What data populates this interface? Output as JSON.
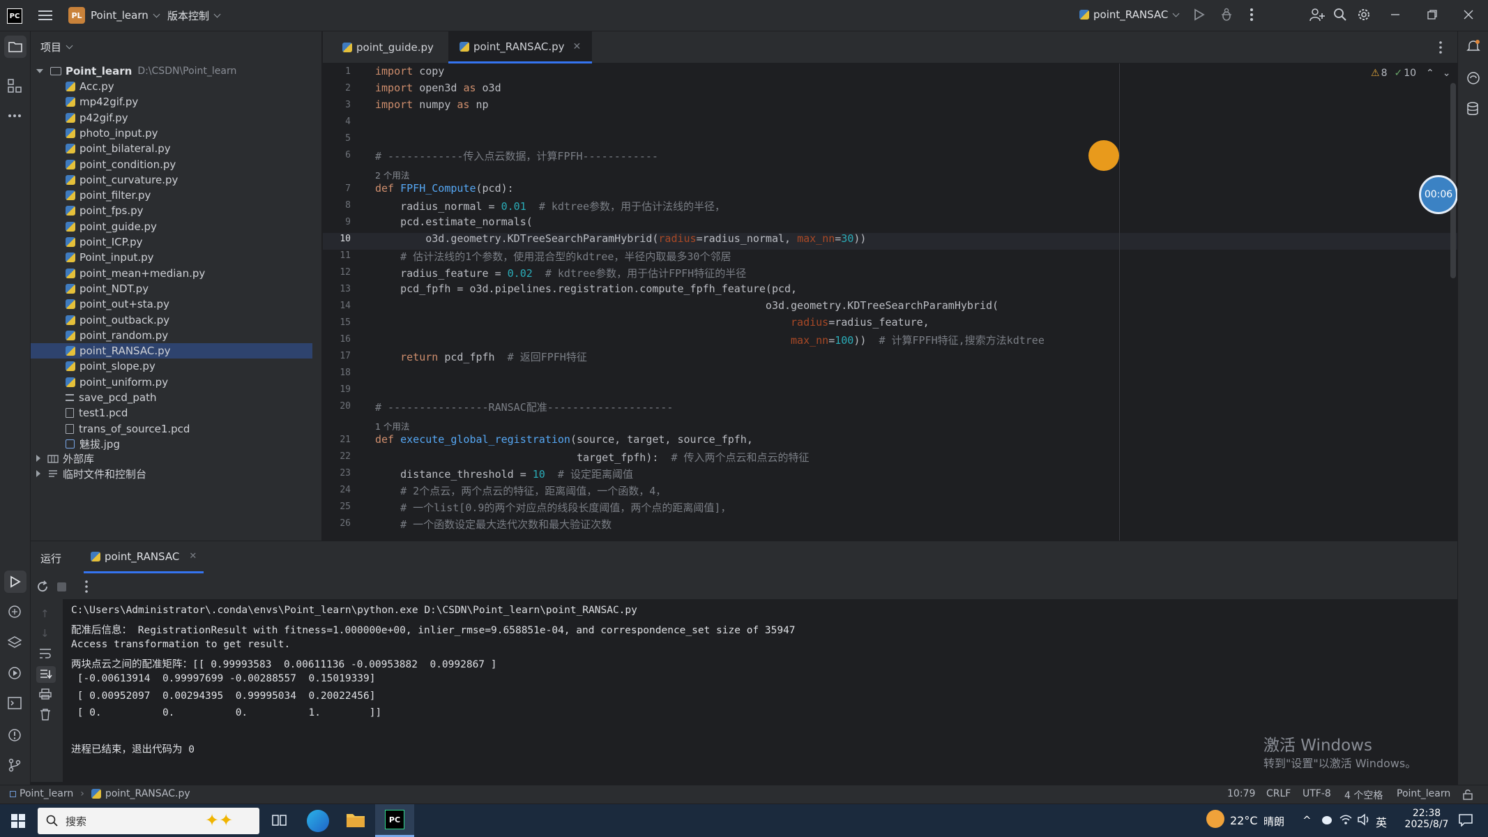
{
  "titlebar": {
    "app_logo": "PC",
    "project_badge": "PL",
    "project_name": "Point_learn",
    "vcs_label": "版本控制",
    "run_config": "point_RANSAC"
  },
  "project_panel": {
    "title": "项目",
    "root_name": "Point_learn",
    "root_path": "D:\\CSDN\\Point_learn",
    "files": [
      {
        "name": "Acc.py",
        "type": "py"
      },
      {
        "name": "mp42gif.py",
        "type": "py"
      },
      {
        "name": "p42gif.py",
        "type": "py"
      },
      {
        "name": "photo_input.py",
        "type": "py"
      },
      {
        "name": "point_bilateral.py",
        "type": "py"
      },
      {
        "name": "point_condition.py",
        "type": "py"
      },
      {
        "name": "point_curvature.py",
        "type": "py"
      },
      {
        "name": "point_filter.py",
        "type": "py"
      },
      {
        "name": "point_fps.py",
        "type": "py"
      },
      {
        "name": "point_guide.py",
        "type": "py"
      },
      {
        "name": "point_ICP.py",
        "type": "py"
      },
      {
        "name": "Point_input.py",
        "type": "py"
      },
      {
        "name": "point_mean+median.py",
        "type": "py"
      },
      {
        "name": "point_NDT.py",
        "type": "py"
      },
      {
        "name": "point_out+sta.py",
        "type": "py"
      },
      {
        "name": "point_outback.py",
        "type": "py"
      },
      {
        "name": "point_random.py",
        "type": "py"
      },
      {
        "name": "point_RANSAC.py",
        "type": "py",
        "selected": true
      },
      {
        "name": "point_slope.py",
        "type": "py"
      },
      {
        "name": "point_uniform.py",
        "type": "py"
      },
      {
        "name": "save_pcd_path",
        "type": "list"
      },
      {
        "name": "test1.pcd",
        "type": "file"
      },
      {
        "name": "trans_of_source1.pcd",
        "type": "file"
      },
      {
        "name": "魅拔.jpg",
        "type": "img"
      }
    ],
    "external_libs": "外部库",
    "scratches": "临时文件和控制台"
  },
  "editor": {
    "tabs": [
      {
        "label": "point_guide.py"
      },
      {
        "label": "point_RANSAC.py",
        "active": true
      }
    ],
    "inspections": {
      "warnings": "8",
      "weak": "10"
    },
    "usages_2": "2 个用法",
    "usages_1": "1 个用法",
    "timer": "00:06"
  },
  "run_panel": {
    "tab_run": "运行",
    "tab_config": "point_RANSAC",
    "console_lines": [
      "C:\\Users\\Administrator\\.conda\\envs\\Point_learn\\python.exe D:\\CSDN\\Point_learn\\point_RANSAC.py",
      "配准后信息： RegistrationResult with fitness=1.000000e+00, inlier_rmse=9.658851e-04, and correspondence_set size of 35947",
      "Access transformation to get result.",
      "两块点云之间的配准矩阵：[[ 0.99993583  0.00611136 -0.00953882  0.0992867 ]",
      " [-0.00613914  0.99997699 -0.00288557  0.15019339]",
      " [ 0.00952097  0.00294395  0.99995034  0.20022456]",
      " [ 0.          0.          0.          1.        ]]",
      "",
      "进程已结束，退出代码为 0"
    ],
    "watermark_title": "激活 Windows",
    "watermark_sub": "转到\"设置\"以激活 Windows。"
  },
  "statusbar": {
    "crumb_project": "Point_learn",
    "crumb_file": "point_RANSAC.py",
    "position": "10:79",
    "line_sep": "CRLF",
    "encoding": "UTF-8",
    "indent": "4 个空格",
    "interpreter": "Point_learn"
  },
  "taskbar": {
    "search_placeholder": "搜索",
    "weather_temp": "22°C",
    "weather_desc": "晴朗",
    "ime": "英",
    "time": "22:38",
    "date": "2025/8/7"
  },
  "colors": {
    "accent": "#3574f0",
    "selection": "#2e436e",
    "keyword": "#cf8e6d",
    "function": "#56a8f5",
    "number": "#2aacb8",
    "comment": "#7a7e85"
  }
}
